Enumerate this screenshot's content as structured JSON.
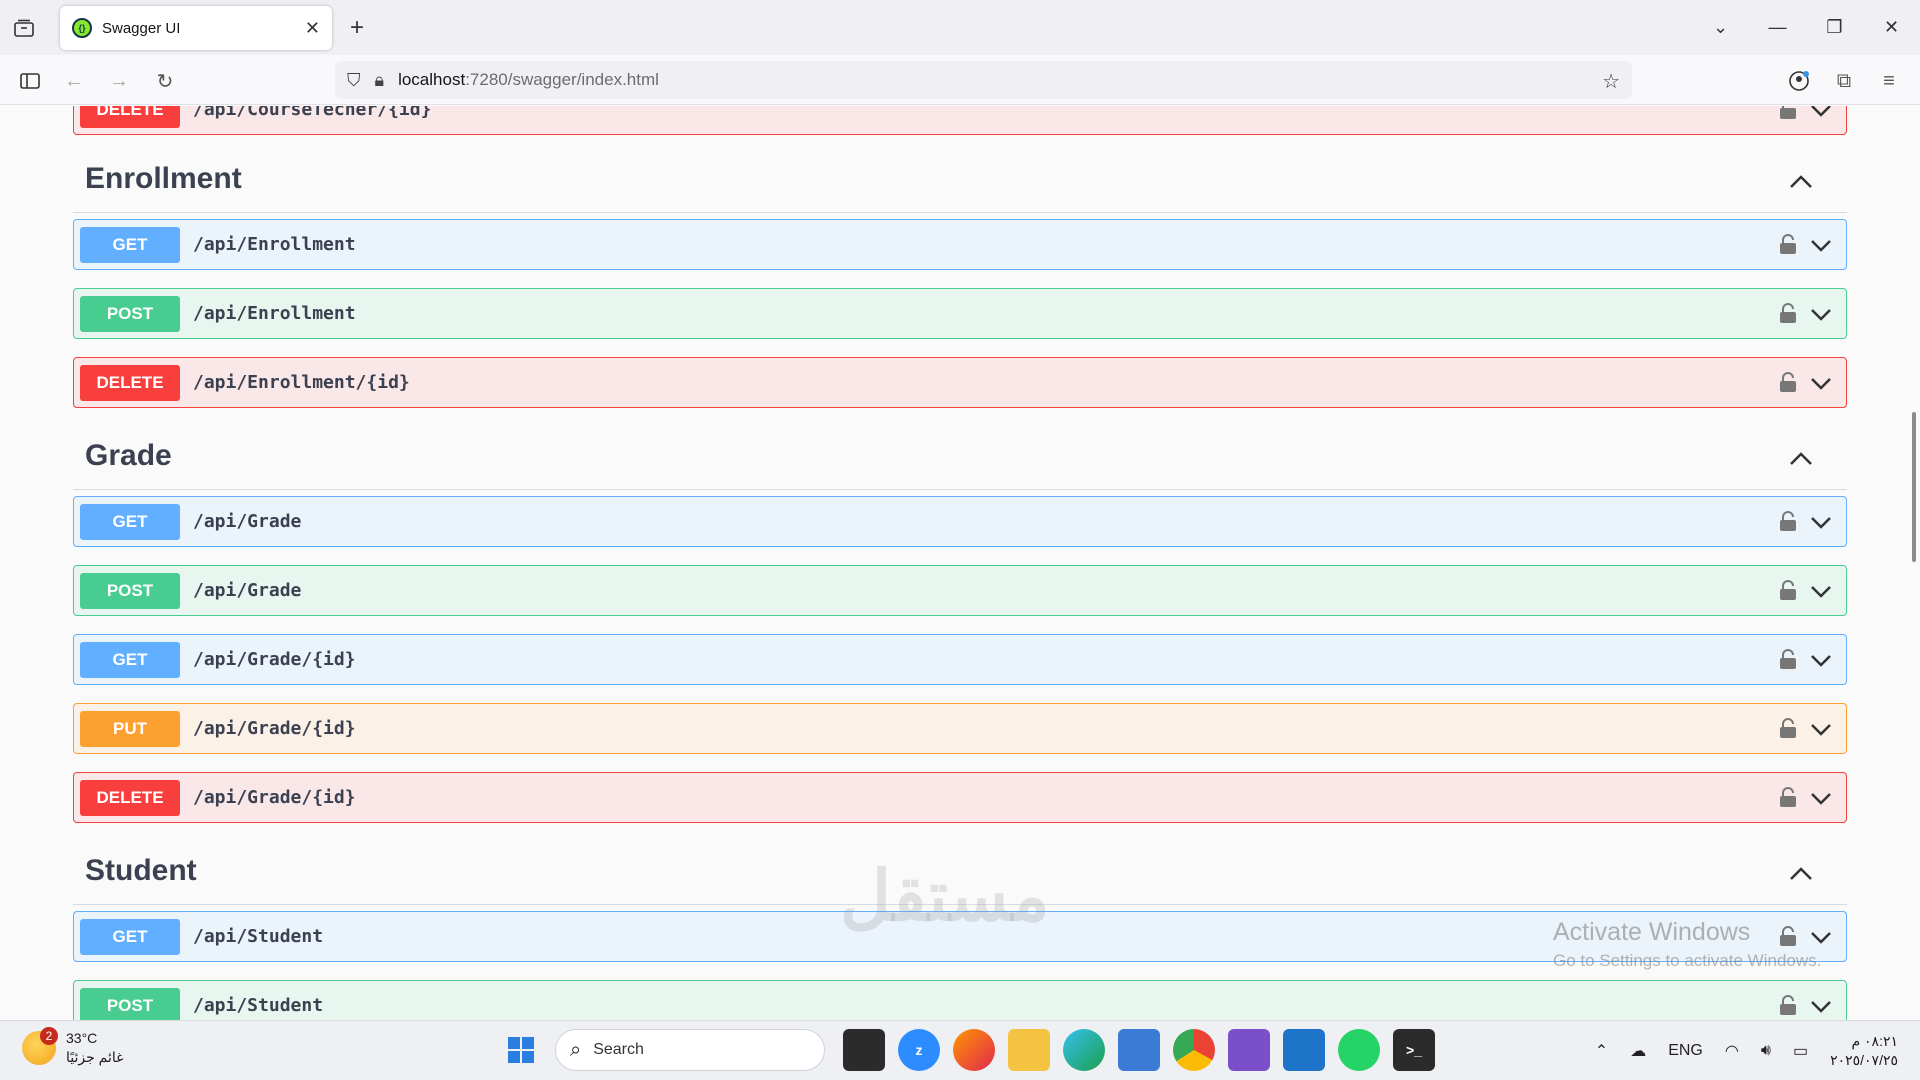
{
  "browser": {
    "tab_title": "Swagger UI",
    "url_host": "localhost",
    "url_path": ":7280/swagger/index.html"
  },
  "top_partial": {
    "method": "DELETE",
    "path": "/api/CourseTecher/{id}"
  },
  "sections": [
    {
      "name": "Enrollment",
      "ops": [
        {
          "method": "GET",
          "path": "/api/Enrollment"
        },
        {
          "method": "POST",
          "path": "/api/Enrollment"
        },
        {
          "method": "DELETE",
          "path": "/api/Enrollment/{id}"
        }
      ]
    },
    {
      "name": "Grade",
      "ops": [
        {
          "method": "GET",
          "path": "/api/Grade"
        },
        {
          "method": "POST",
          "path": "/api/Grade"
        },
        {
          "method": "GET",
          "path": "/api/Grade/{id}"
        },
        {
          "method": "PUT",
          "path": "/api/Grade/{id}"
        },
        {
          "method": "DELETE",
          "path": "/api/Grade/{id}"
        }
      ]
    },
    {
      "name": "Student",
      "ops": [
        {
          "method": "GET",
          "path": "/api/Student"
        },
        {
          "method": "POST",
          "path": "/api/Student"
        }
      ]
    }
  ],
  "watermark": {
    "line1": "Activate Windows",
    "line2": "Go to Settings to activate Windows.",
    "brand": "مستقل"
  },
  "taskbar": {
    "weather_temp": "33°C",
    "weather_desc": "غائم جزئيًا",
    "weather_badge": "2",
    "search_label": "Search",
    "lang": "ENG",
    "time": "٠٨:٢١ م",
    "date": "٢٠٢٥/٠٧/٢٥"
  },
  "colors": {
    "get": "#61affe",
    "post": "#49cc90",
    "delete": "#f93e3e",
    "put": "#fca130"
  }
}
